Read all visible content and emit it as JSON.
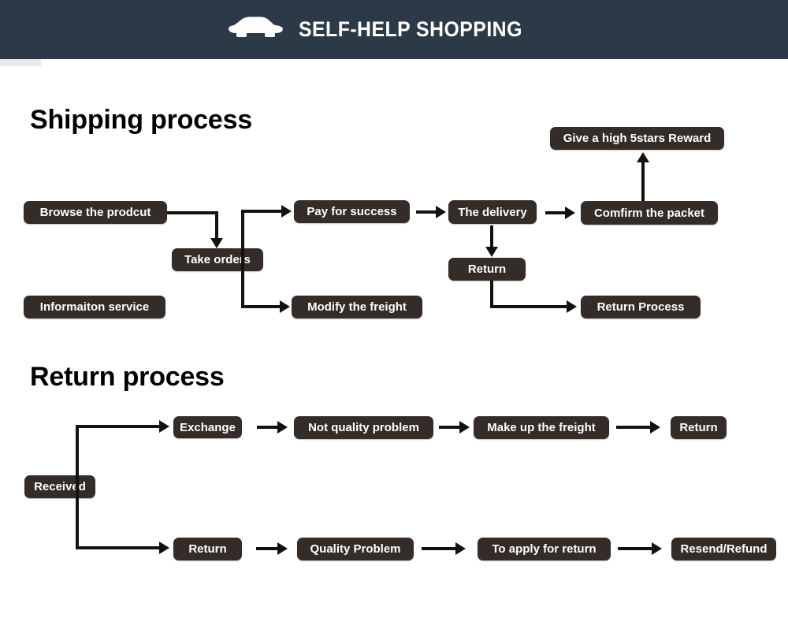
{
  "header": {
    "title": "SELF-HELP SHOPPING",
    "icon": "car-icon",
    "background_color": "#2c3a48",
    "text_color": "#ffffff"
  },
  "theme": {
    "page_background": "#ffffff",
    "node_background": "#332c29",
    "node_text_color": "#ffffff",
    "connector_color": "#141210",
    "heading_color": "#000000"
  },
  "sections": [
    {
      "id": "shipping",
      "title": "Shipping process",
      "nodes": [
        {
          "id": "browse-the-prodcut",
          "label": "Browse the prodcut"
        },
        {
          "id": "take-orders",
          "label": "Take orders"
        },
        {
          "id": "informaiton-service",
          "label": "Informaiton service"
        },
        {
          "id": "pay-for-success",
          "label": "Pay for success"
        },
        {
          "id": "modify-the-freight",
          "label": "Modify the freight"
        },
        {
          "id": "the-delivery",
          "label": "The delivery"
        },
        {
          "id": "comfirm-the-packet",
          "label": "Comfirm the packet"
        },
        {
          "id": "give-a-high-5stars-reward",
          "label": "Give a high 5stars Reward"
        },
        {
          "id": "return",
          "label": "Return"
        },
        {
          "id": "return-process",
          "label": "Return Process"
        }
      ]
    },
    {
      "id": "return",
      "title": "Return process",
      "nodes": [
        {
          "id": "received",
          "label": "Received"
        },
        {
          "id": "exchange",
          "label": "Exchange"
        },
        {
          "id": "not-quality-problem",
          "label": "Not quality problem"
        },
        {
          "id": "make-up-the-freight",
          "label": "Make up the freight"
        },
        {
          "id": "return-top",
          "label": "Return"
        },
        {
          "id": "return-bottom",
          "label": "Return"
        },
        {
          "id": "quality-problem",
          "label": "Quality Problem"
        },
        {
          "id": "to-apply-for-return",
          "label": "To apply for return"
        },
        {
          "id": "resend-refund",
          "label": "Resend/Refund"
        }
      ]
    }
  ]
}
